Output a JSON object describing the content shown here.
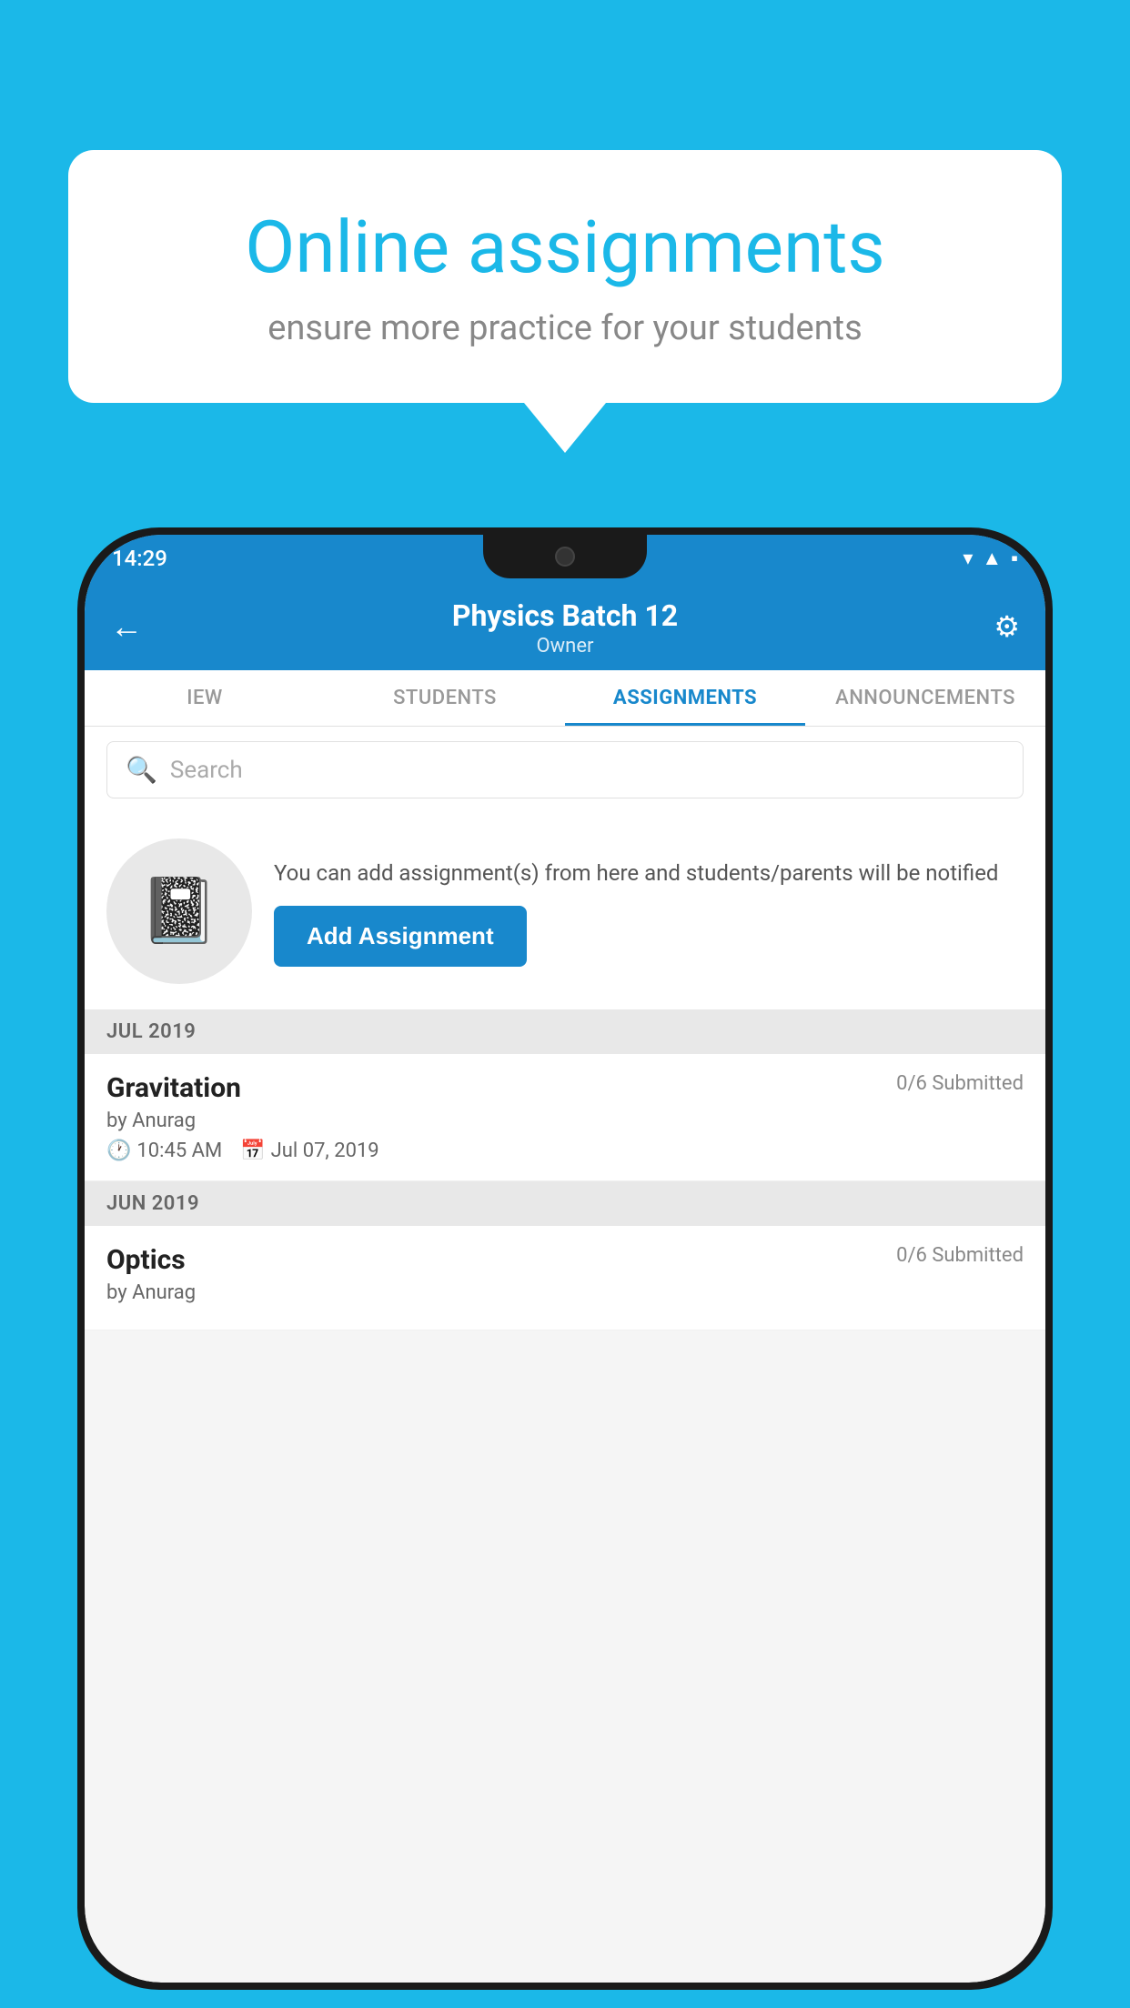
{
  "background_color": "#1BB8E8",
  "speech_bubble": {
    "title": "Online assignments",
    "subtitle": "ensure more practice for your students"
  },
  "status_bar": {
    "time": "14:29",
    "icons": [
      "wifi",
      "signal",
      "battery"
    ]
  },
  "header": {
    "title": "Physics Batch 12",
    "subtitle": "Owner",
    "back_label": "←",
    "settings_label": "⚙"
  },
  "tabs": [
    {
      "label": "IEW",
      "active": false
    },
    {
      "label": "STUDENTS",
      "active": false
    },
    {
      "label": "ASSIGNMENTS",
      "active": true
    },
    {
      "label": "ANNOUNCEMENTS",
      "active": false
    }
  ],
  "search": {
    "placeholder": "Search"
  },
  "empty_state": {
    "description": "You can add assignment(s) from here and students/parents will be notified",
    "button_label": "Add Assignment"
  },
  "sections": [
    {
      "label": "JUL 2019",
      "assignments": [
        {
          "name": "Gravitation",
          "submitted": "0/6 Submitted",
          "author": "by Anurag",
          "time": "10:45 AM",
          "date": "Jul 07, 2019"
        }
      ]
    },
    {
      "label": "JUN 2019",
      "assignments": [
        {
          "name": "Optics",
          "submitted": "0/6 Submitted",
          "author": "by Anurag",
          "time": "",
          "date": ""
        }
      ]
    }
  ]
}
